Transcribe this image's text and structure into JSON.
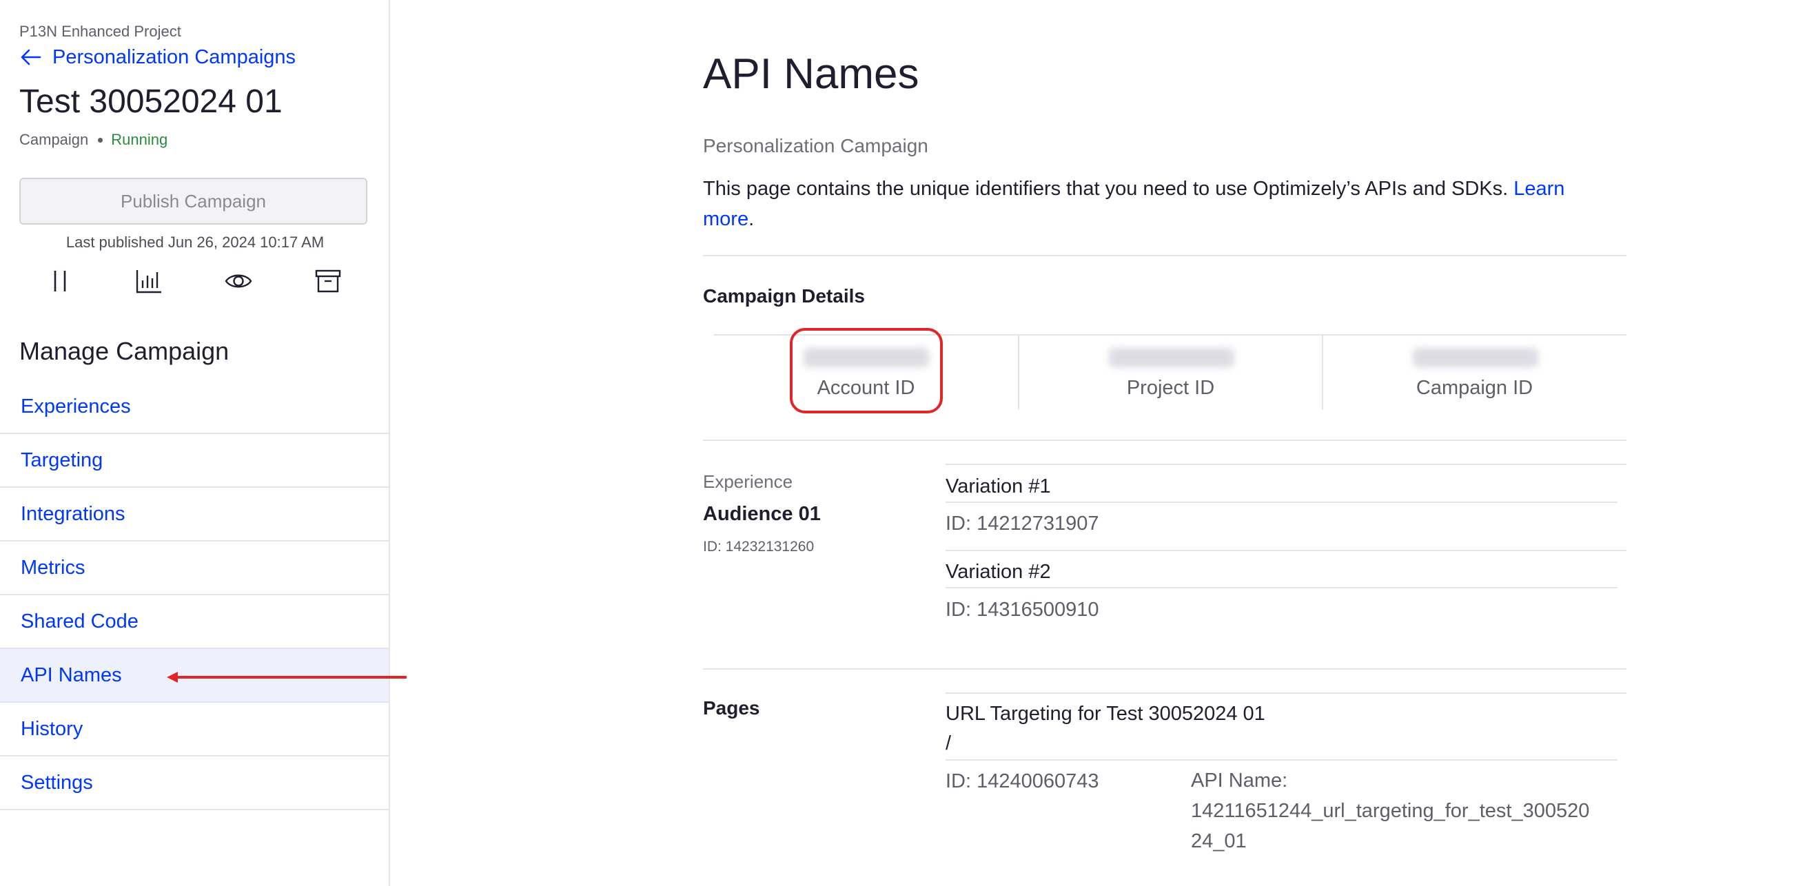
{
  "sidebar": {
    "project_name": "P13N Enhanced Project",
    "back_link": "Personalization Campaigns",
    "campaign_title": "Test 30052024 01",
    "campaign_type": "Campaign",
    "campaign_status": "Running",
    "publish_button": "Publish Campaign",
    "last_published": "Last published Jun 26, 2024 10:17 AM",
    "icons": [
      "pause-icon",
      "results-chart-icon",
      "preview-eye-icon",
      "archive-icon"
    ],
    "manage_title": "Manage Campaign",
    "nav": [
      {
        "label": "Experiences"
      },
      {
        "label": "Targeting"
      },
      {
        "label": "Integrations"
      },
      {
        "label": "Metrics"
      },
      {
        "label": "Shared Code"
      },
      {
        "label": "API Names",
        "active": true
      },
      {
        "label": "History"
      },
      {
        "label": "Settings"
      }
    ]
  },
  "main": {
    "title": "API Names",
    "subtitle": "Personalization Campaign",
    "description": "This page contains the unique identifiers that you need to use Optimizely’s APIs and SDKs.",
    "learn_more": "Learn more",
    "campaign_details_heading": "Campaign Details",
    "ids": [
      {
        "label": "Account ID"
      },
      {
        "label": "Project ID"
      },
      {
        "label": "Campaign ID"
      }
    ],
    "experience": {
      "label": "Experience",
      "name": "Audience 01",
      "id": "ID: 14232131260",
      "variations": [
        {
          "name": "Variation #1",
          "id": "ID: 14212731907"
        },
        {
          "name": "Variation #2",
          "id": "ID: 14316500910"
        }
      ]
    },
    "pages": {
      "heading": "Pages",
      "name": "URL Targeting for Test 30052024 01",
      "path": "/",
      "id": "ID: 14240060743",
      "api_name_label": "API Name:",
      "api_name": "14211651244_url_targeting_for_test_30052024_01"
    }
  },
  "colors": {
    "link": "#0037ff",
    "status_running": "#2b8a3e",
    "annotation_red": "#e0262a",
    "active_nav_bg": "#eef1fb"
  }
}
